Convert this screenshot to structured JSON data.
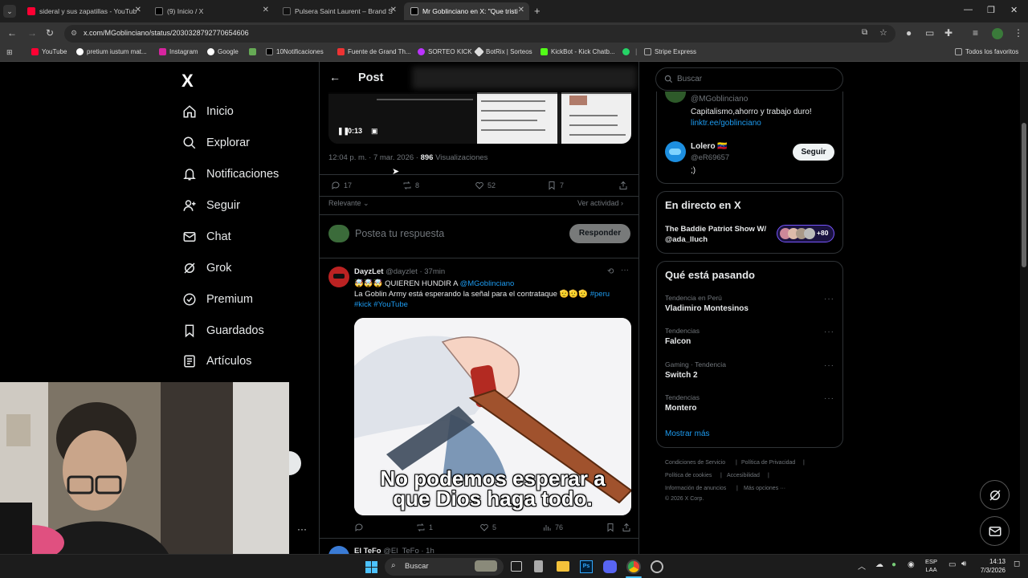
{
  "browser": {
    "tabs": [
      {
        "title": "sideral y sus zapatillas - YouTub",
        "color": "#ff0033"
      },
      {
        "title": "(9) Inicio / X",
        "color": "#000000"
      },
      {
        "title": "Pulsera Saint Laurent – Brand S",
        "color": "#111111"
      },
      {
        "title": "Mr Goblinciano en X: \"Que tristi",
        "color": "#000000"
      }
    ],
    "url": "x.com/MGoblinciano/status/2030328792770654606",
    "bookmarks": [
      "YouTube",
      "pretium iustum mat...",
      "Instagram",
      "Google",
      "10Notificaciones",
      "Fuente de Grand Th...",
      "SORTEO KICK",
      "BotRix | Sorteos",
      "KickBot - Kick Chatb...",
      "Stripe Express"
    ],
    "all_bookmarks": "Todos los favoritos"
  },
  "nav": {
    "logo": "X",
    "items": [
      "Inicio",
      "Explorar",
      "Notificaciones",
      "Seguir",
      "Chat",
      "Grok",
      "Premium",
      "Guardados",
      "Artículos"
    ]
  },
  "header": {
    "title": "Post"
  },
  "video": {
    "time": "0:13"
  },
  "post": {
    "timestamp": "12:04 p. m. · 7 mar. 2026 ·",
    "views": "896",
    "views_label": "Visualizaciones",
    "replies": "17",
    "reposts": "8",
    "likes": "52",
    "bookmarks": "7",
    "sort": "Relevante",
    "activity": "Ver actividad"
  },
  "compose": {
    "placeholder": "Postea tu respuesta",
    "button": "Responder"
  },
  "reply": {
    "name": "DayzLet",
    "handle": "@dayzlet · 37min",
    "text_pre": "🤯🤯🤯 QUIEREN HUNDIR A ",
    "mention": "@MGoblinciano",
    "line2": "La Goblin Army está esperando la señal para el contrataque 🫡🫡🫡 ",
    "tag1": "#peru",
    "tag2": "#kick",
    "tag3": "#YouTube",
    "meme_line1": "No podemos esperar a",
    "meme_line2": "que Dios haga todo.",
    "replies": "",
    "reposts": "1",
    "likes": "5",
    "views": "76"
  },
  "reply2": {
    "name": "El TeFo",
    "handle": "@El_TeFo · 1h"
  },
  "search": {
    "placeholder": "Buscar"
  },
  "profile_card": {
    "handle": "@MGoblinciano",
    "bio": "Capitalismo,ahorro y trabajo duro!",
    "link": "linktr.ee/goblinciano"
  },
  "suggest": {
    "name": "Lolero 🇻🇪",
    "handle": "@eR69657",
    "bio": ";)",
    "button": "Seguir"
  },
  "live": {
    "title": "En directo en X",
    "show": "The Baddie Patriot Show W/ @ada_lluch",
    "count": "+80"
  },
  "trends": {
    "title": "Qué está pasando",
    "items": [
      {
        "meta": "Tendencia en Perú",
        "name": "Vladimiro Montesinos"
      },
      {
        "meta": "Tendencias",
        "name": "Falcon"
      },
      {
        "meta": "Gaming · Tendencia",
        "name": "Switch 2"
      },
      {
        "meta": "Tendencias",
        "name": "Montero"
      }
    ],
    "more": "Mostrar más"
  },
  "footer": {
    "links": [
      "Condiciones de Servicio",
      "Política de Privacidad",
      "Política de cookies",
      "Accesibilidad",
      "Información de anuncios",
      "Más opciones ···"
    ],
    "copyright": "© 2026 X Corp."
  },
  "taskbar": {
    "search": "Buscar",
    "lang1": "ESP",
    "lang2": "LAA",
    "time": "14:13",
    "date": "7/3/2026"
  }
}
